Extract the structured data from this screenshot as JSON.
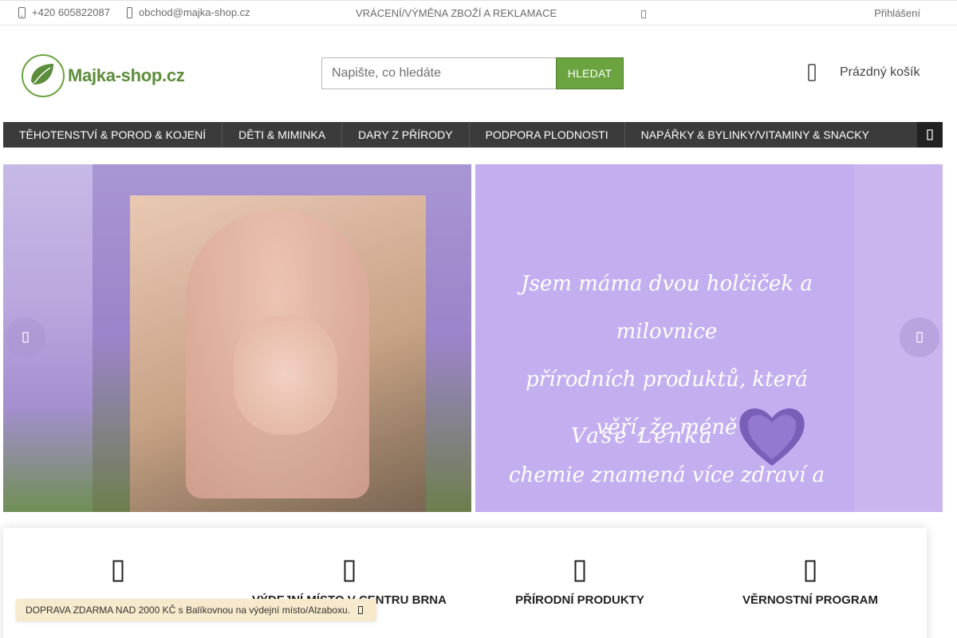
{
  "topbar": {
    "phone": "+420 605822087",
    "email": "obchod@majka-shop.cz",
    "returns_link": "VRÁCENÍ/VÝMĚNA ZBOŽÍ A REKLAMACE",
    "login": "Přihlášení"
  },
  "header": {
    "logo_text": "Majka-shop.cz",
    "search_placeholder": "Napište, co hledáte",
    "search_button": "HLEDAT",
    "cart_label": "Prázdný košík"
  },
  "nav": {
    "items": [
      "TĚHOTENSTVÍ & POROD & KOJENÍ",
      "DĚTI & MIMINKA",
      "DARY Z PŘÍRODY",
      "PODPORA PLODNOSTI",
      "NAPÁŘKY & BYLINKY/VITAMINY & SNACKY"
    ]
  },
  "banner": {
    "quote_lines": [
      "Jsem máma dvou holčiček a milovnice",
      "přírodních produktů, která věří, že méně",
      "chemie znamená více zdraví a pohody."
    ],
    "signature": "Vaše Lenka"
  },
  "benefits": {
    "items": [
      "",
      "VÝDEJNÍ MÍSTO V CENTRU BRNA",
      "PŘÍRODNÍ PRODUKTY",
      "VĚRNOSTNÍ PROGRAM"
    ]
  },
  "toast": {
    "text": "DOPRAVA ZDARMA NAD 2000 KČ s Balíkovnou na výdejní místo/Alzaboxu."
  },
  "colors": {
    "brand_green": "#6aa33f",
    "nav_bg": "#3b3b3b",
    "banner_lavender": "#c3aff0",
    "toast_bg": "#f7eacc"
  },
  "icons": {
    "phone": "phone-icon",
    "email": "envelope-icon",
    "cart": "cart-icon",
    "search": "search-button",
    "menu_more": "chevron-right-icon",
    "slider_prev": "chevron-left-icon",
    "slider_next": "chevron-right-icon"
  }
}
